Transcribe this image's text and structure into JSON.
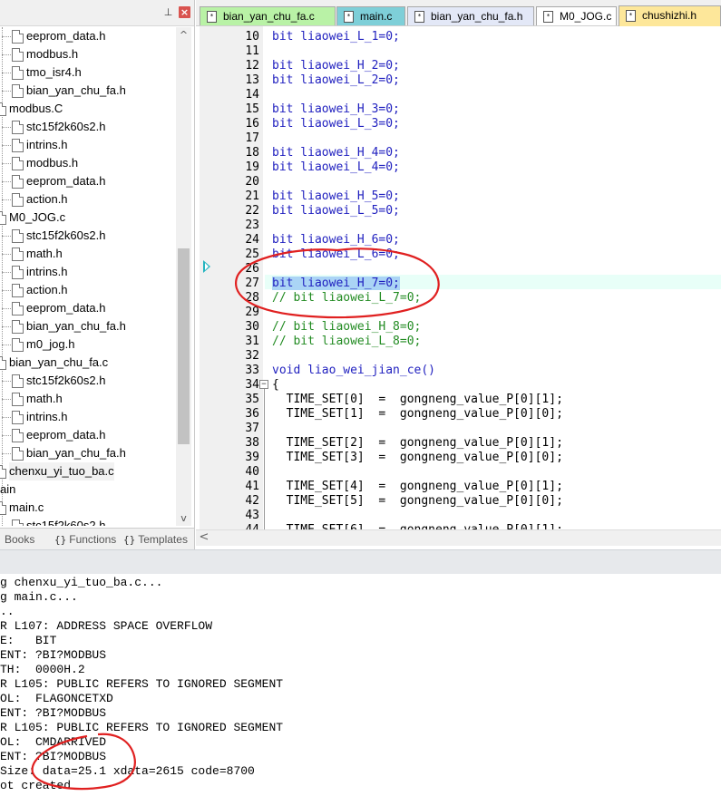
{
  "project_tree": {
    "items": [
      {
        "label": "eeprom_data.h",
        "level": 2
      },
      {
        "label": "modbus.h",
        "level": 2
      },
      {
        "label": "tmo_isr4.h",
        "level": 2
      },
      {
        "label": "bian_yan_chu_fa.h",
        "level": 2
      },
      {
        "label": "modbus.C",
        "level": 1
      },
      {
        "label": "stc15f2k60s2.h",
        "level": 2
      },
      {
        "label": "intrins.h",
        "level": 2
      },
      {
        "label": "modbus.h",
        "level": 2
      },
      {
        "label": "eeprom_data.h",
        "level": 2
      },
      {
        "label": "action.h",
        "level": 2
      },
      {
        "label": "M0_JOG.c",
        "level": 1
      },
      {
        "label": "stc15f2k60s2.h",
        "level": 2
      },
      {
        "label": "math.h",
        "level": 2
      },
      {
        "label": "intrins.h",
        "level": 2
      },
      {
        "label": "action.h",
        "level": 2
      },
      {
        "label": "eeprom_data.h",
        "level": 2
      },
      {
        "label": "bian_yan_chu_fa.h",
        "level": 2
      },
      {
        "label": "m0_jog.h",
        "level": 2
      },
      {
        "label": "bian_yan_chu_fa.c",
        "level": 1
      },
      {
        "label": "stc15f2k60s2.h",
        "level": 2
      },
      {
        "label": "math.h",
        "level": 2
      },
      {
        "label": "intrins.h",
        "level": 2
      },
      {
        "label": "eeprom_data.h",
        "level": 2
      },
      {
        "label": "bian_yan_chu_fa.h",
        "level": 2
      },
      {
        "label": "chenxu_yi_tuo_ba.c",
        "level": 1
      },
      {
        "label": "ain",
        "level": 0
      },
      {
        "label": "main.c",
        "level": 1
      },
      {
        "label": "stc15f2k60s2.h",
        "level": 2
      }
    ]
  },
  "panel_bottom_tabs": [
    {
      "icon": "",
      "label": "Books"
    },
    {
      "icon": "{}",
      "label": "Functions"
    },
    {
      "icon": "{}",
      "label": "Templates"
    }
  ],
  "editor_tabs": [
    {
      "label": "bian_yan_chu_fa.c",
      "color": "#b9f2a6",
      "active": false
    },
    {
      "label": "main.c",
      "color": "#7ecfd8",
      "active": false
    },
    {
      "label": "bian_yan_chu_fa.h",
      "color": "#e3e8f7",
      "active": false
    },
    {
      "label": "M0_JOG.c",
      "color": "#ffffff",
      "active": false
    },
    {
      "label": "chushizhi.h",
      "color": "#fde79a",
      "active": true
    }
  ],
  "code_lines": [
    {
      "num": "10",
      "text": "bit liaowei_L_1=0;",
      "kind": "code"
    },
    {
      "num": "11",
      "text": "",
      "kind": "code"
    },
    {
      "num": "12",
      "text": "bit liaowei_H_2=0;",
      "kind": "code"
    },
    {
      "num": "13",
      "text": "bit liaowei_L_2=0;",
      "kind": "code"
    },
    {
      "num": "14",
      "text": "",
      "kind": "code"
    },
    {
      "num": "15",
      "text": "bit liaowei_H_3=0;",
      "kind": "code"
    },
    {
      "num": "16",
      "text": "bit liaowei_L_3=0;",
      "kind": "code"
    },
    {
      "num": "17",
      "text": "",
      "kind": "code"
    },
    {
      "num": "18",
      "text": "bit liaowei_H_4=0;",
      "kind": "code"
    },
    {
      "num": "19",
      "text": "bit liaowei_L_4=0;",
      "kind": "code"
    },
    {
      "num": "20",
      "text": "",
      "kind": "code"
    },
    {
      "num": "21",
      "text": "bit liaowei_H_5=0;",
      "kind": "code"
    },
    {
      "num": "22",
      "text": "bit liaowei_L_5=0;",
      "kind": "code"
    },
    {
      "num": "23",
      "text": "",
      "kind": "code"
    },
    {
      "num": "24",
      "text": "bit liaowei_H_6=0;",
      "kind": "code"
    },
    {
      "num": "25",
      "text": "bit liaowei_L_6=0;",
      "kind": "code"
    },
    {
      "num": "26",
      "text": "",
      "kind": "code"
    },
    {
      "num": "27",
      "text": "bit liaowei_H_7=0;",
      "kind": "selected"
    },
    {
      "num": "28",
      "text": "// bit liaowei_L_7=0;",
      "kind": "comment"
    },
    {
      "num": "29",
      "text": "",
      "kind": "code"
    },
    {
      "num": "30",
      "text": "// bit liaowei_H_8=0;",
      "kind": "comment"
    },
    {
      "num": "31",
      "text": "// bit liaowei_L_8=0;",
      "kind": "comment"
    },
    {
      "num": "32",
      "text": "",
      "kind": "code"
    },
    {
      "num": "33",
      "text": "void liao_wei_jian_ce()",
      "kind": "code"
    },
    {
      "num": "34",
      "text": "{",
      "kind": "dark"
    },
    {
      "num": "35",
      "text": "  TIME_SET[0]  =  gongneng_value_P[0][1];",
      "kind": "dark"
    },
    {
      "num": "36",
      "text": "  TIME_SET[1]  =  gongneng_value_P[0][0];",
      "kind": "dark"
    },
    {
      "num": "37",
      "text": "",
      "kind": "dark"
    },
    {
      "num": "38",
      "text": "  TIME_SET[2]  =  gongneng_value_P[0][1];",
      "kind": "dark"
    },
    {
      "num": "39",
      "text": "  TIME_SET[3]  =  gongneng_value_P[0][0];",
      "kind": "dark"
    },
    {
      "num": "40",
      "text": "",
      "kind": "dark"
    },
    {
      "num": "41",
      "text": "  TIME_SET[4]  =  gongneng_value_P[0][1];",
      "kind": "dark"
    },
    {
      "num": "42",
      "text": "  TIME_SET[5]  =  gongneng_value_P[0][0];",
      "kind": "dark"
    },
    {
      "num": "43",
      "text": "",
      "kind": "dark"
    },
    {
      "num": "44",
      "text": "  TIME_SET[6]  =  gongneng_value_P[0][1];",
      "kind": "dark"
    }
  ],
  "output_lines": [
    "g chenxu_yi_tuo_ba.c...",
    "g main.c...",
    "..",
    "R L107: ADDRESS SPACE OVERFLOW",
    "E:   BIT",
    "ENT: ?BI?MODBUS",
    "TH:  0000H.2",
    "R L105: PUBLIC REFERS TO IGNORED SEGMENT",
    "OL:  FLAGONCETXD",
    "ENT: ?BI?MODBUS",
    "R L105: PUBLIC REFERS TO IGNORED SEGMENT",
    "OL:  CMDARRIVED",
    "ENT: ?BI?MODBUS",
    "Size: data=25.1 xdata=2615 code=8700",
    "ot created"
  ],
  "colors": {
    "annotation": "#e02020",
    "selection": "#aad4f5",
    "current_line": "#e8fff8",
    "comment": "#228b22",
    "keyword": "#1f1fbf"
  },
  "icons": {
    "pin": "pin-icon",
    "close": "close-icon",
    "scroll_up": "chevron-up-icon",
    "scroll_down": "chevron-down-icon"
  }
}
